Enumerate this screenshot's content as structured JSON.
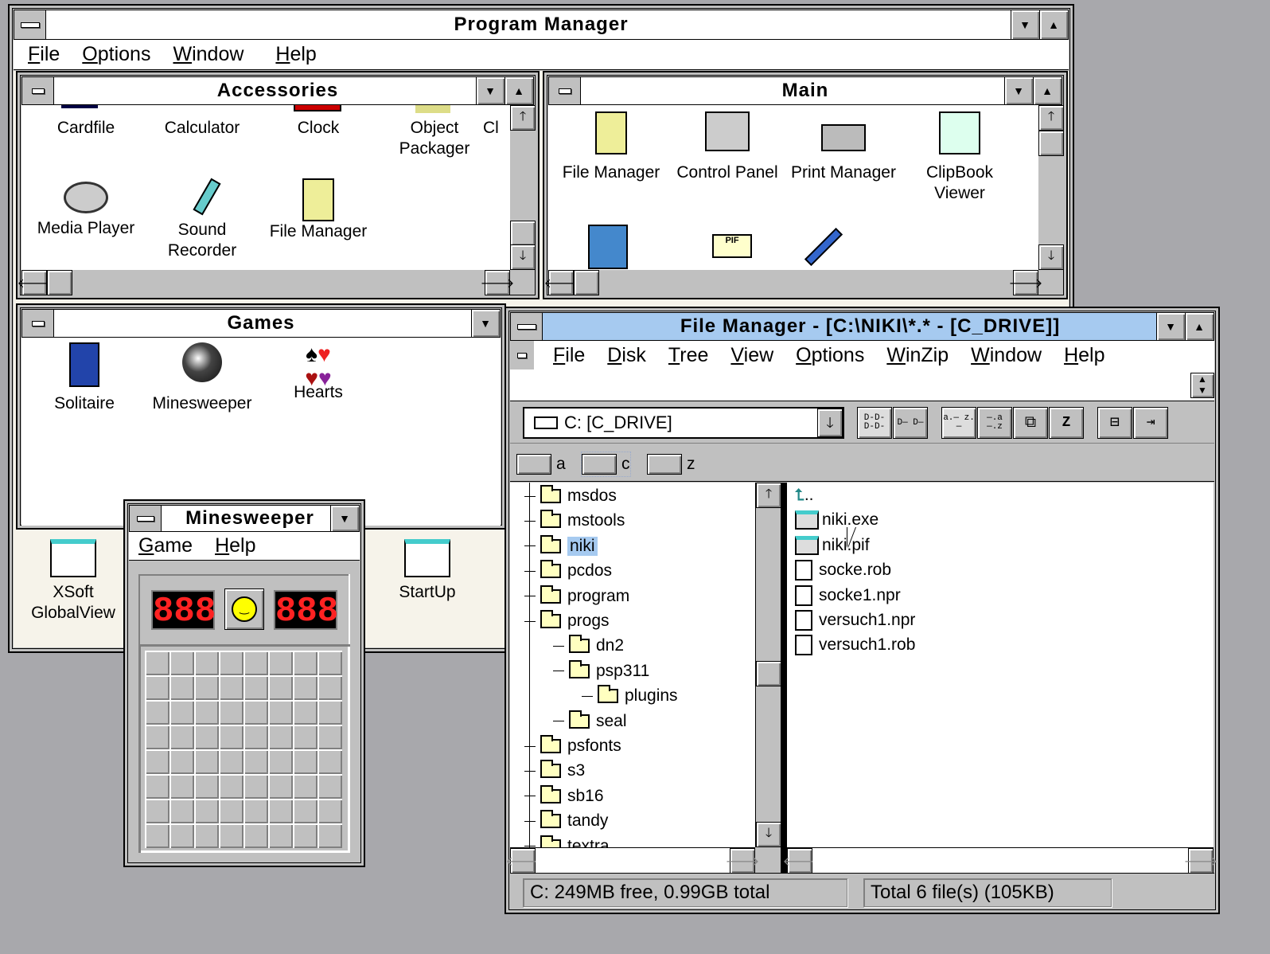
{
  "program_manager": {
    "title": "Program Manager",
    "menu": [
      "File",
      "Options",
      "Window",
      "Help"
    ],
    "minimized_groups": [
      {
        "label_line1": "XSoft",
        "label_line2": "GlobalView"
      },
      {
        "label_line1": "StartUp",
        "label_line2": ""
      }
    ]
  },
  "accessories": {
    "title": "Accessories",
    "icons": [
      {
        "name": "Cardfile",
        "line2": ""
      },
      {
        "name": "Calculator",
        "line2": ""
      },
      {
        "name": "Clock",
        "line2": ""
      },
      {
        "name": "Object",
        "line2": "Packager"
      },
      {
        "name": "Cl",
        "line2": ""
      },
      {
        "name": "Media Player",
        "line2": ""
      },
      {
        "name": "Sound",
        "line2": "Recorder"
      },
      {
        "name": "File Manager",
        "line2": ""
      }
    ]
  },
  "main": {
    "title": "Main",
    "icons": [
      {
        "name": "File Manager",
        "line2": ""
      },
      {
        "name": "Control Panel",
        "line2": ""
      },
      {
        "name": "Print Manager",
        "line2": ""
      },
      {
        "name": "ClipBook",
        "line2": "Viewer"
      }
    ],
    "pif_label": "PIF"
  },
  "games": {
    "title": "Games",
    "icons": [
      {
        "name": "Solitaire"
      },
      {
        "name": "Minesweeper"
      },
      {
        "name": "Hearts"
      }
    ]
  },
  "minesweeper": {
    "title": "Minesweeper",
    "menu": [
      "Game",
      "Help"
    ],
    "mines_counter": "888",
    "timer": "888",
    "rows": 8,
    "cols": 8
  },
  "file_manager": {
    "title": "File Manager - [C:\\NIKI\\*.* - [C_DRIVE]]",
    "menu": [
      "File",
      "Disk",
      "Tree",
      "View",
      "Options",
      "WinZip",
      "Window",
      "Help"
    ],
    "drive_select": "C: [C_DRIVE]",
    "toolbar_buttons": [
      "D-D- D-D-",
      "D— D—",
      "a.— z.—",
      "—.a —.z",
      "copy",
      "zip",
      "disk-connect",
      "disk-disconnect"
    ],
    "drives": [
      "a",
      "c",
      "z"
    ],
    "selected_drive": "c",
    "tree": [
      {
        "name": "msdos",
        "level": 1
      },
      {
        "name": "mstools",
        "level": 1
      },
      {
        "name": "niki",
        "level": 1,
        "selected": true
      },
      {
        "name": "pcdos",
        "level": 1
      },
      {
        "name": "program",
        "level": 1
      },
      {
        "name": "progs",
        "level": 1
      },
      {
        "name": "dn2",
        "level": 2
      },
      {
        "name": "psp311",
        "level": 2
      },
      {
        "name": "plugins",
        "level": 3
      },
      {
        "name": "seal",
        "level": 2
      },
      {
        "name": "psfonts",
        "level": 1
      },
      {
        "name": "s3",
        "level": 1
      },
      {
        "name": "sb16",
        "level": 1
      },
      {
        "name": "tandy",
        "level": 1
      },
      {
        "name": "textra",
        "level": 1
      }
    ],
    "files": [
      {
        "name": "..",
        "type": "up"
      },
      {
        "name": "niki.exe",
        "type": "program"
      },
      {
        "name": "niki.pif",
        "type": "program"
      },
      {
        "name": "socke.rob",
        "type": "document"
      },
      {
        "name": "socke1.npr",
        "type": "document"
      },
      {
        "name": "versuch1.npr",
        "type": "document"
      },
      {
        "name": "versuch1.rob",
        "type": "document"
      }
    ],
    "status_left": "C: 249MB free,  0.99GB total",
    "status_right": "Total 6 file(s) (105KB)"
  },
  "colors": {
    "desktop": "#a8a8ac",
    "active_title": "#a6caf0",
    "selection": "#a6caf0",
    "window_bg": "#c0c0c0"
  }
}
